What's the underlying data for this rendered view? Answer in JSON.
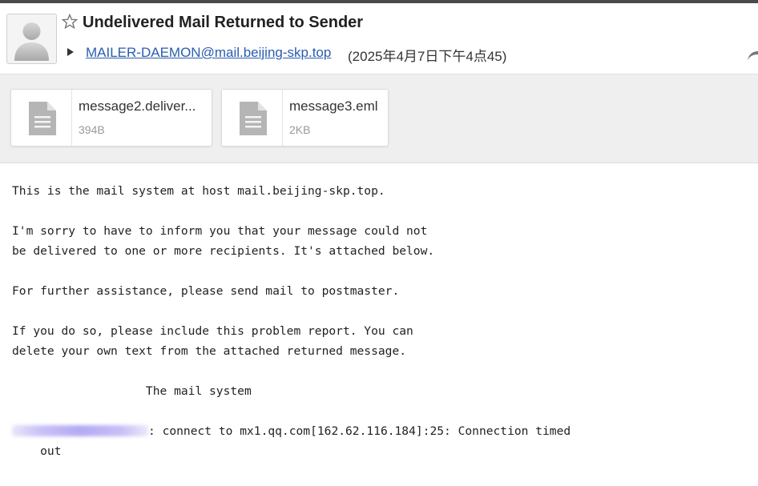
{
  "message": {
    "subject": "Undelivered Mail Returned to Sender",
    "sender": "MAILER-DAEMON@mail.beijing-skp.top",
    "date": "(2025年4月7日下午4点45)"
  },
  "attachments": [
    {
      "name": "message2.deliver...",
      "size": "394B",
      "icon": "document-icon"
    },
    {
      "name": "message3.eml",
      "size": "2KB",
      "icon": "document-icon"
    }
  ],
  "body": {
    "line1": "This is the mail system at host mail.beijing-skp.top.",
    "line2": "I'm sorry to have to inform you that your message could not",
    "line3": "be delivered to one or more recipients. It's attached below.",
    "line4": "For further assistance, please send mail to postmaster.",
    "line5": "If you do so, please include this problem report. You can",
    "line6": "delete your own text from the attached returned message.",
    "line7": "                   The mail system",
    "line8": ": connect to mx1.qq.com[162.62.116.184]:25: Connection timed",
    "line9": "    out"
  },
  "colors": {
    "link": "#2a5db0",
    "attach_bg": "#efefef"
  }
}
